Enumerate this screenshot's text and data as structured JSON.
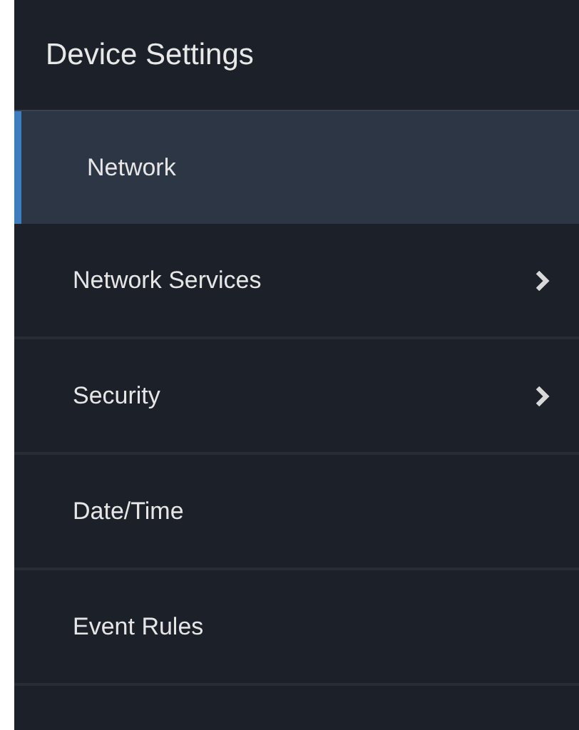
{
  "header": {
    "title": "Device Settings"
  },
  "items": [
    {
      "label": "Network",
      "selected": true,
      "has_submenu": false
    },
    {
      "label": "Network Services",
      "selected": false,
      "has_submenu": true
    },
    {
      "label": "Security",
      "selected": false,
      "has_submenu": true
    },
    {
      "label": "Date/Time",
      "selected": false,
      "has_submenu": false
    },
    {
      "label": "Event Rules",
      "selected": false,
      "has_submenu": false
    }
  ]
}
